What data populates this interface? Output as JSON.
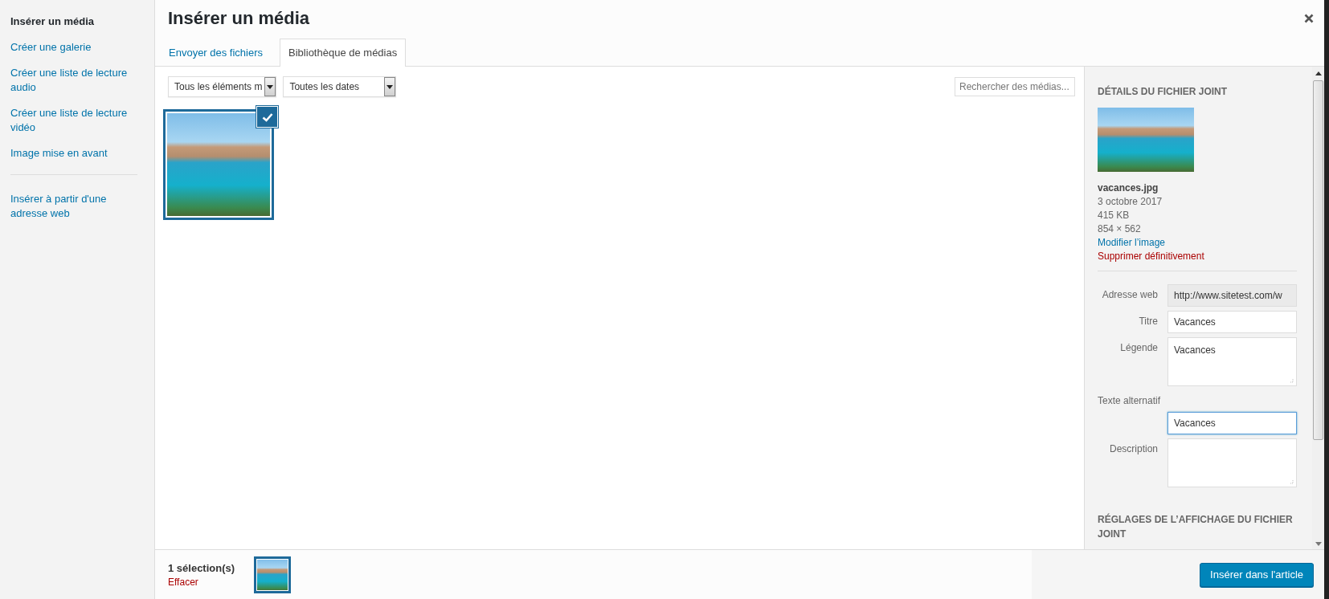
{
  "sidebar": {
    "groups": [
      {
        "items": [
          {
            "label": "Insérer un média",
            "selected": true
          },
          {
            "label": "Créer une galerie",
            "selected": false
          },
          {
            "label": "Créer une liste de lecture audio",
            "selected": false
          },
          {
            "label": "Créer une liste de lecture vidéo",
            "selected": false
          },
          {
            "label": "Image mise en avant",
            "selected": false
          }
        ]
      },
      {
        "items": [
          {
            "label": "Insérer à partir d'une adresse web",
            "selected": false
          }
        ]
      }
    ]
  },
  "modal": {
    "title": "Insérer un média"
  },
  "tabs": [
    {
      "label": "Envoyer des fichiers",
      "selected": false
    },
    {
      "label": "Bibliothèque de médias",
      "selected": true
    }
  ],
  "filters": [
    {
      "value": "Tous les éléments m"
    },
    {
      "value": "Toutes les dates"
    }
  ],
  "search": {
    "placeholder": "Rechercher des médias..."
  },
  "attachments": [
    {
      "selected": true
    }
  ],
  "details": {
    "heading": "DÉTAILS DU FICHIER JOINT",
    "filename": "vacances.jpg",
    "date": "3 octobre 2017",
    "size": "415 KB",
    "dimensions": "854 × 562",
    "edit_link": "Modifier l’image",
    "delete_link": "Supprimer définitivement",
    "fields": [
      {
        "kind": "readonly",
        "label": "Adresse web",
        "value": "http://www.sitetest.com/w",
        "focused": false
      },
      {
        "kind": "text",
        "label": "Titre",
        "value": "Vacances",
        "focused": false
      },
      {
        "kind": "textarea",
        "label": "Légende",
        "value": "Vacances",
        "focused": false
      },
      {
        "kind": "text-above",
        "label": "Texte alternatif",
        "value": "Vacances",
        "focused": true
      },
      {
        "kind": "textarea",
        "label": "Description",
        "focused": false
      }
    ],
    "settings_heading": "RÉGLAGES DE L’AFFICHAGE DU FICHIER JOINT"
  },
  "selection": {
    "count": "1 sélection(s)",
    "clear": "Effacer"
  },
  "insert_button": "Insérer dans l'article"
}
